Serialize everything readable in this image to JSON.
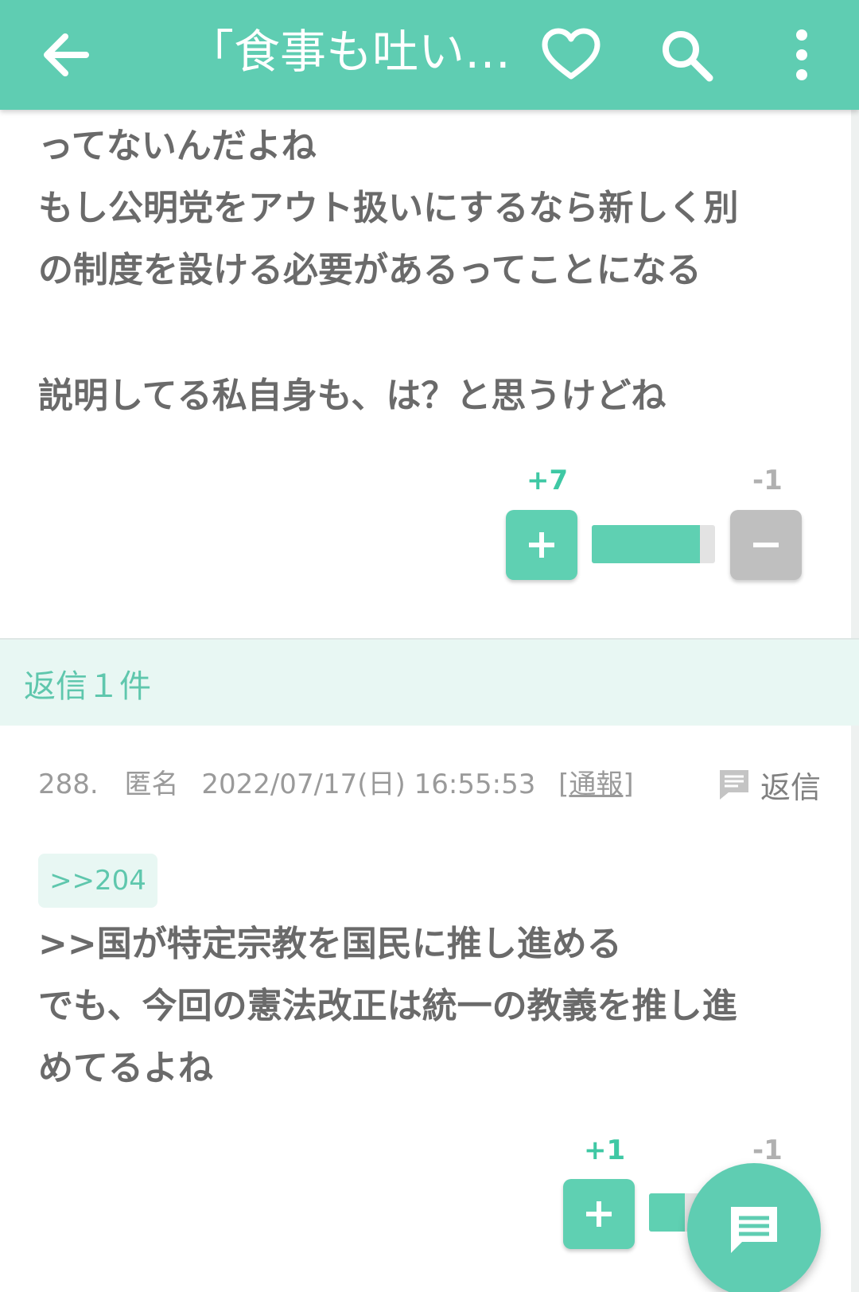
{
  "appbar": {
    "title": "「食事も吐い…",
    "icons": [
      "back-arrow-icon",
      "heart-icon",
      "search-icon",
      "more-vert-icon"
    ]
  },
  "comment_top": {
    "lines": [
      "ってないんだよね",
      "もし公明党をアウト扱いにするなら新しく別",
      "の制度を設ける必要があるってことになる",
      "",
      "説明してる私自身も、は？と思うけどね"
    ],
    "votes": {
      "plus": "+7",
      "minus": "-1",
      "ratio": 0.875
    }
  },
  "reply_header": {
    "label": "返信１件"
  },
  "comment_288": {
    "number": "288.",
    "author": "匿名",
    "date": "2022/07/17(日) 16:55:53",
    "report_open": "[",
    "report_label": "通報",
    "report_close": "]",
    "reply_label": "返信",
    "anchor": ">>204",
    "lines": [
      ">>国が特定宗教を国民に推し進める",
      "でも、今回の憲法改正は統一の教義を推し進",
      "めてるよね"
    ],
    "votes": {
      "plus": "+1",
      "minus": "-1",
      "ratio": 0.5
    }
  },
  "fab": {
    "icon": "comment-icon"
  },
  "colors": {
    "accent": "#5fcdb2",
    "accent_light": "#e8f7f3",
    "text": "#6a6a6a",
    "muted": "#9a9a9a",
    "minus_button": "#bfbfbf"
  }
}
